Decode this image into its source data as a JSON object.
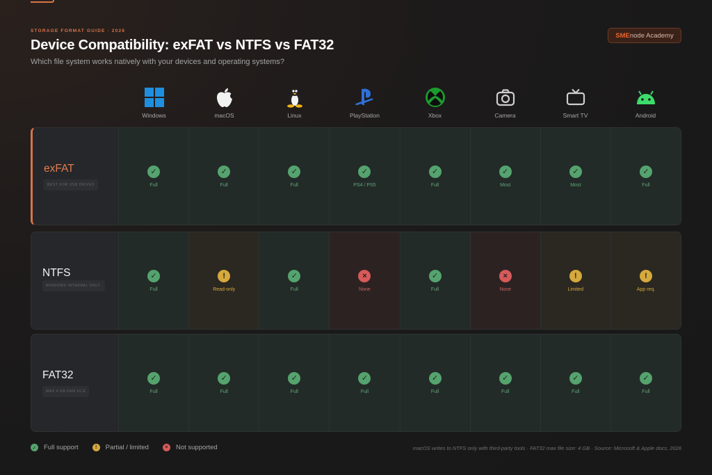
{
  "header": {
    "eyebrow": "STORAGE FORMAT GUIDE · 2026",
    "title": "Device Compatibility: exFAT vs NTFS vs FAT32",
    "subtitle": "Which file system works natively with your devices and operating systems?",
    "brand_prefix": "SME",
    "brand_suffix": "node Academy"
  },
  "devices": [
    {
      "label": "Windows",
      "icon": "windows-icon"
    },
    {
      "label": "macOS",
      "icon": "apple-icon"
    },
    {
      "label": "Linux",
      "icon": "linux-icon"
    },
    {
      "label": "PlayStation",
      "icon": "playstation-icon"
    },
    {
      "label": "Xbox",
      "icon": "xbox-icon"
    },
    {
      "label": "Camera",
      "icon": "camera-icon"
    },
    {
      "label": "Smart TV",
      "icon": "tv-icon"
    },
    {
      "label": "Android",
      "icon": "android-icon"
    }
  ],
  "rows": [
    {
      "name": "exFAT",
      "tag": "BEST FOR USB DRIVES",
      "cells": [
        {
          "status": "full",
          "text": "Full"
        },
        {
          "status": "full",
          "text": "Full"
        },
        {
          "status": "full",
          "text": "Full"
        },
        {
          "status": "full",
          "text": "PS4 / PS5"
        },
        {
          "status": "full",
          "text": "Full"
        },
        {
          "status": "full",
          "text": "Most"
        },
        {
          "status": "full",
          "text": "Most"
        },
        {
          "status": "full",
          "text": "Full"
        }
      ]
    },
    {
      "name": "NTFS",
      "tag": "WINDOWS INTERNAL ONLY",
      "cells": [
        {
          "status": "full",
          "text": "Full"
        },
        {
          "status": "partial",
          "text": "Read-only"
        },
        {
          "status": "full",
          "text": "Full"
        },
        {
          "status": "none",
          "text": "None"
        },
        {
          "status": "full",
          "text": "Full"
        },
        {
          "status": "none",
          "text": "None"
        },
        {
          "status": "partial",
          "text": "Limited"
        },
        {
          "status": "partial",
          "text": "App req."
        }
      ]
    },
    {
      "name": "FAT32",
      "tag": "MAX 4 GB PER FILE",
      "cells": [
        {
          "status": "full",
          "text": "Full"
        },
        {
          "status": "full",
          "text": "Full"
        },
        {
          "status": "full",
          "text": "Full"
        },
        {
          "status": "full",
          "text": "Full"
        },
        {
          "status": "full",
          "text": "Full"
        },
        {
          "status": "full",
          "text": "Full"
        },
        {
          "status": "full",
          "text": "Full"
        },
        {
          "status": "full",
          "text": "Full"
        }
      ]
    }
  ],
  "legend": {
    "full": "Full support",
    "partial": "Partial / limited",
    "none": "Not supported"
  },
  "footnote": "macOS writes to NTFS only with third-party tools  ·  FAT32 max file size: 4 GB  ·  Source: Microsoft & Apple docs, 2026",
  "colors": {
    "accent": "#d9744a",
    "full": "#55a36e",
    "partial": "#d6a93d",
    "none": "#d75a5a"
  }
}
